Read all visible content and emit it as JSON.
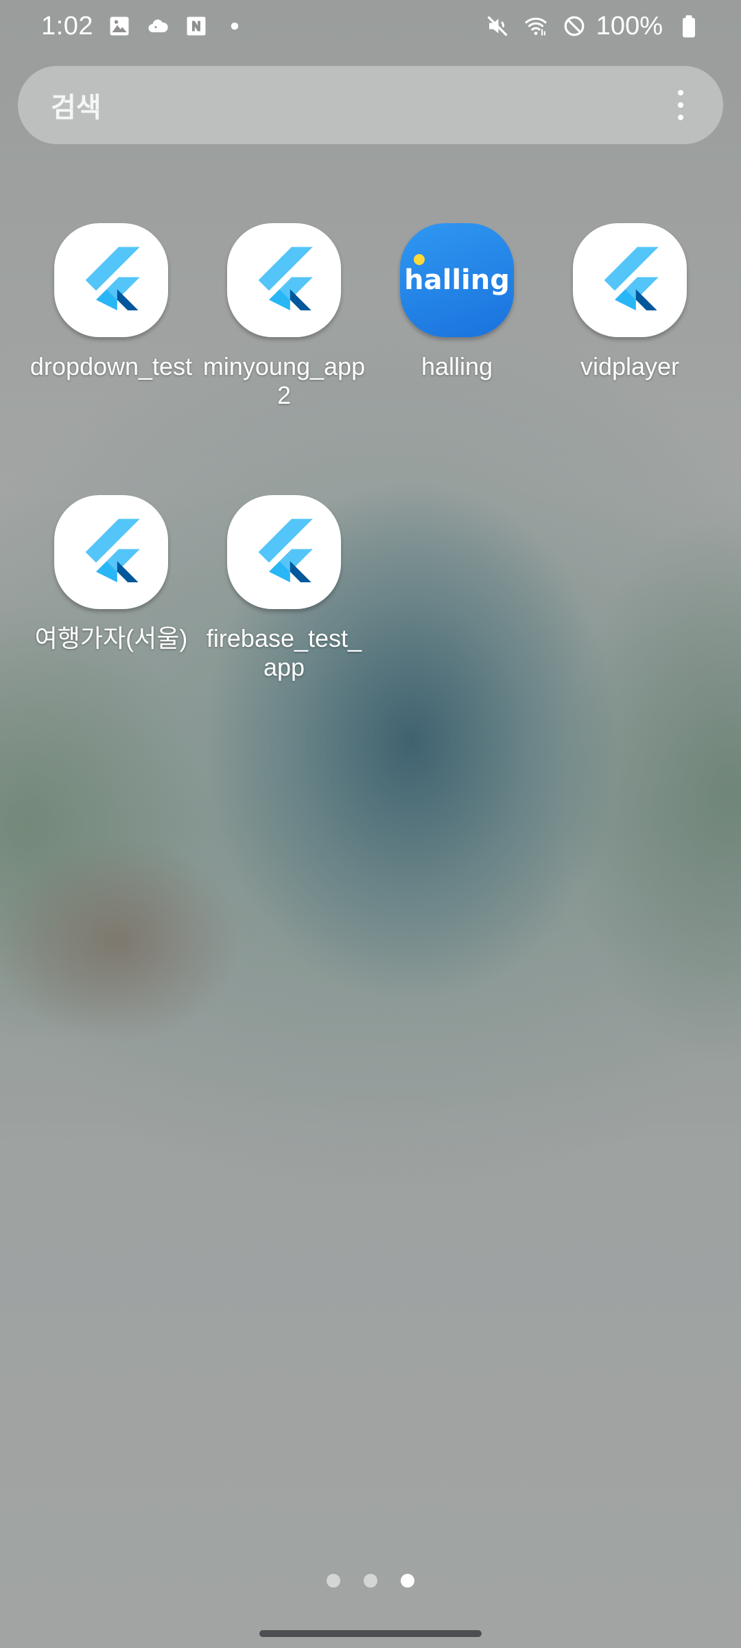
{
  "status_bar": {
    "time": "1:02",
    "battery_percent": "100%",
    "left_icons": [
      "gallery-icon",
      "cloud-icon",
      "naver-icon",
      "dot-icon"
    ],
    "right_icons": [
      "mute-icon",
      "wifi-icon",
      "do-not-disturb-icon",
      "battery-icon"
    ]
  },
  "search": {
    "placeholder": "검색"
  },
  "apps": [
    {
      "label": "dropdown_test",
      "icon": "flutter-icon"
    },
    {
      "label": "minyoung_app\n2",
      "icon": "flutter-icon"
    },
    {
      "label": "halling",
      "icon": "halling-icon",
      "icon_text": "halling",
      "color": "#1f7fe6"
    },
    {
      "label": "vidplayer",
      "icon": "flutter-icon"
    },
    {
      "label": "여행가자(서울)",
      "icon": "flutter-icon"
    },
    {
      "label": "firebase_test_\napp",
      "icon": "flutter-icon"
    }
  ],
  "page_indicator": {
    "pages": 3,
    "active_page": 3
  },
  "colors": {
    "flutter_light": "#54c5f8",
    "flutter_mid": "#29b6f6",
    "flutter_dark": "#01579b",
    "halling_blue": "#1f7fe6",
    "halling_dot": "#ffd83a"
  }
}
